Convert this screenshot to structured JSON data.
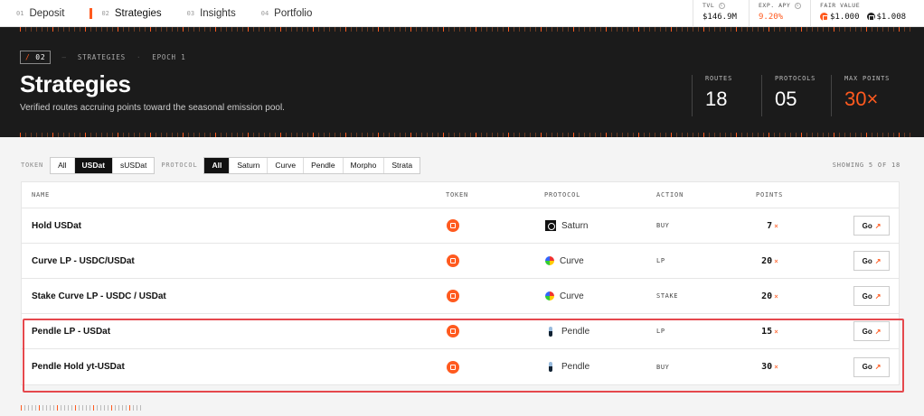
{
  "nav": [
    {
      "num": "01",
      "label": "Deposit",
      "active": false
    },
    {
      "num": "02",
      "label": "Strategies",
      "active": true
    },
    {
      "num": "03",
      "label": "Insights",
      "active": false
    },
    {
      "num": "04",
      "label": "Portfolio",
      "active": false
    }
  ],
  "top_stats": {
    "tvl_label": "TVL",
    "tvl_value": "$146.9M",
    "apy_label": "EXP. APY",
    "apy_value": "9.20%",
    "fair_label": "FAIR VALUE",
    "fair_value_1": "$1.000",
    "fair_value_2": "$1.008"
  },
  "hero": {
    "section_num": "02",
    "section_slash": "/",
    "crumb_1": "STRATEGIES",
    "crumb_2": "EPOCH 1",
    "title": "Strategies",
    "subtitle": "Verified routes accruing points toward the seasonal emission pool.",
    "stats": [
      {
        "label": "ROUTES",
        "value": "18",
        "accent": false
      },
      {
        "label": "PROTOCOLS",
        "value": "05",
        "accent": false
      },
      {
        "label": "MAX POINTS",
        "value": "30×",
        "accent": true
      }
    ]
  },
  "filters": {
    "token_label": "TOKEN",
    "token_options": [
      "All",
      "USDat",
      "sUSDat"
    ],
    "token_selected": "USDat",
    "protocol_label": "PROTOCOL",
    "protocol_options": [
      "All",
      "Saturn",
      "Curve",
      "Pendle",
      "Morpho",
      "Strata"
    ],
    "protocol_selected": "All",
    "showing": "SHOWING 5 OF 18"
  },
  "table": {
    "headers": {
      "name": "NAME",
      "token": "TOKEN",
      "protocol": "PROTOCOL",
      "action": "ACTION",
      "points": "POINTS"
    },
    "go_label": "Go",
    "rows": [
      {
        "name": "Hold USDat",
        "protocol": "Saturn",
        "protocol_icon": "saturn-icon",
        "action": "BUY",
        "points": "7",
        "suffix": "×"
      },
      {
        "name": "Curve LP - USDC/USDat",
        "protocol": "Curve",
        "protocol_icon": "curve-icon",
        "action": "LP",
        "points": "20",
        "suffix": "×"
      },
      {
        "name": "Stake Curve LP - USDC / USDat",
        "protocol": "Curve",
        "protocol_icon": "curve-icon",
        "action": "STAKE",
        "points": "20",
        "suffix": "×"
      },
      {
        "name": "Pendle LP - USDat",
        "protocol": "Pendle",
        "protocol_icon": "pendle-icon",
        "action": "LP",
        "points": "15",
        "suffix": "×"
      },
      {
        "name": "Pendle Hold yt-USDat",
        "protocol": "Pendle",
        "protocol_icon": "pendle-icon",
        "action": "BUY",
        "points": "30",
        "suffix": "×"
      }
    ]
  },
  "colors": {
    "accent": "#ff5a1f",
    "hero_bg": "#1b1b1b",
    "highlight": "#e5484d"
  }
}
